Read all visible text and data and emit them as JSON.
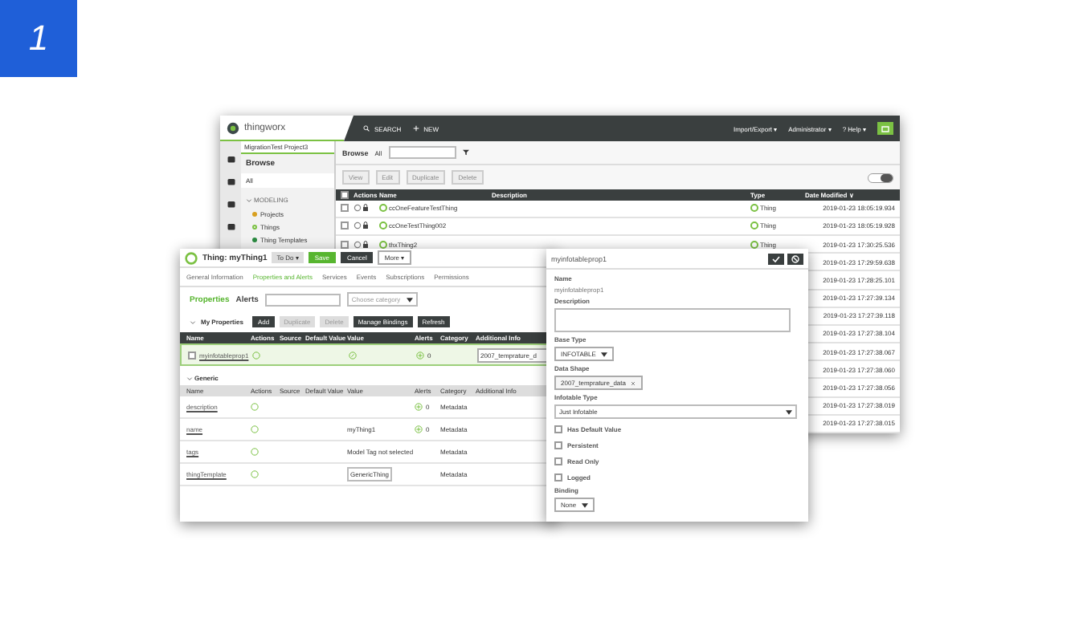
{
  "badge": "1",
  "back_window": {
    "logo": "thingworx",
    "search": "SEARCH",
    "new": "NEW",
    "menus": [
      "Import/Export ▾",
      "Administrator ▾",
      "? Help ▾"
    ],
    "project": "MigrationTest Project3",
    "nav_title": "Browse",
    "nav_filter": "All",
    "section": "MODELING",
    "nav_items": [
      {
        "label": "Projects",
        "kind": "project"
      },
      {
        "label": "Things",
        "kind": "thing"
      },
      {
        "label": "Thing Templates",
        "kind": "template"
      }
    ],
    "browse_title": "Browse",
    "browse_filter": "All",
    "tools": [
      "View",
      "Edit",
      "Duplicate",
      "Delete"
    ],
    "select_all_checked": false,
    "columns": [
      "Actions",
      "Name",
      "Description",
      "Type",
      "Date Modified ∨"
    ],
    "rows": [
      {
        "checked": false,
        "name": "ccOneFeatureTestThing",
        "type": "Thing",
        "date": "2019-01-23 18:05:19.934"
      },
      {
        "checked": false,
        "name": "ccOneTestThing002",
        "type": "Thing",
        "date": "2019-01-23 18:05:19.928"
      },
      {
        "checked": false,
        "name": "thxThing2",
        "type": "Thing",
        "date": "2019-01-23 17:30:25.536"
      },
      {
        "date": "2019-01-23 17:29:59.638"
      },
      {
        "date": "2019-01-23 17:28:25.101"
      },
      {
        "date": "2019-01-23 17:27:39.134"
      },
      {
        "date": "2019-01-23 17:27:39.118"
      },
      {
        "date": "2019-01-23 17:27:38.104"
      },
      {
        "date": "2019-01-23 17:27:38.067"
      },
      {
        "date": "2019-01-23 17:27:38.060"
      },
      {
        "date": "2019-01-23 17:27:38.056"
      },
      {
        "date": "2019-01-23 17:27:38.019"
      },
      {
        "date": "2019-01-23 17:27:38.015"
      }
    ]
  },
  "thing_window": {
    "title": "Thing: myThing1",
    "todo": "To Do ▾",
    "save": "Save",
    "cancel": "Cancel",
    "more": "More ▾",
    "tabs": [
      {
        "label": "General Information",
        "selected": false
      },
      {
        "label": "Properties and Alerts",
        "selected": true
      },
      {
        "label": "Services",
        "selected": false
      },
      {
        "label": "Events",
        "selected": false
      },
      {
        "label": "Subscriptions",
        "selected": false
      },
      {
        "label": "Permissions",
        "selected": false
      }
    ],
    "subtabs": [
      {
        "label": "Properties",
        "selected": true
      },
      {
        "label": "Alerts",
        "selected": false
      }
    ],
    "category_placeholder": "Choose category",
    "my_properties": "My Properties",
    "actions": [
      {
        "label": "Add",
        "disabled": false
      },
      {
        "label": "Duplicate",
        "disabled": true
      },
      {
        "label": "Delete",
        "disabled": true
      },
      {
        "label": "Manage Bindings",
        "disabled": false
      },
      {
        "label": "Refresh",
        "disabled": false
      }
    ],
    "columns": [
      "Name",
      "Actions",
      "Source",
      "Default Value",
      "Value",
      "Alerts",
      "Category",
      "Additional Info"
    ],
    "my_rows": [
      {
        "checked": false,
        "name": "myinfotableprop1",
        "alerts": "0",
        "info": "2007_temprature_d"
      }
    ],
    "generic": "Generic",
    "generic_columns": [
      "Name",
      "Actions",
      "Source",
      "Default Value",
      "Value",
      "Alerts",
      "Category",
      "Additional Info"
    ],
    "generic_rows": [
      {
        "name": "description",
        "alerts": "0",
        "category": "Metadata"
      },
      {
        "name": "name",
        "value": "myThing1",
        "alerts": "0",
        "category": "Metadata"
      },
      {
        "name": "tags",
        "value": "Model Tag not selected",
        "category": "Metadata"
      },
      {
        "name": "thingTemplate",
        "value": "GenericThing",
        "chip": true,
        "category": "Metadata"
      }
    ]
  },
  "property_panel": {
    "title": "myinfotableprop1",
    "name_label": "Name",
    "name_value": "myinfotableprop1",
    "description_label": "Description",
    "base_type_label": "Base Type",
    "base_type": "INFOTABLE",
    "data_shape_label": "Data Shape",
    "data_shape": "2007_temprature_data",
    "infotable_type_label": "Infotable Type",
    "infotable_type": "Just Infotable",
    "checks": [
      {
        "label": "Has Default Value",
        "checked": false
      },
      {
        "label": "Persistent",
        "checked": false
      },
      {
        "label": "Read Only",
        "checked": false
      },
      {
        "label": "Logged",
        "checked": false
      }
    ],
    "binding_label": "Binding",
    "binding": "None"
  }
}
